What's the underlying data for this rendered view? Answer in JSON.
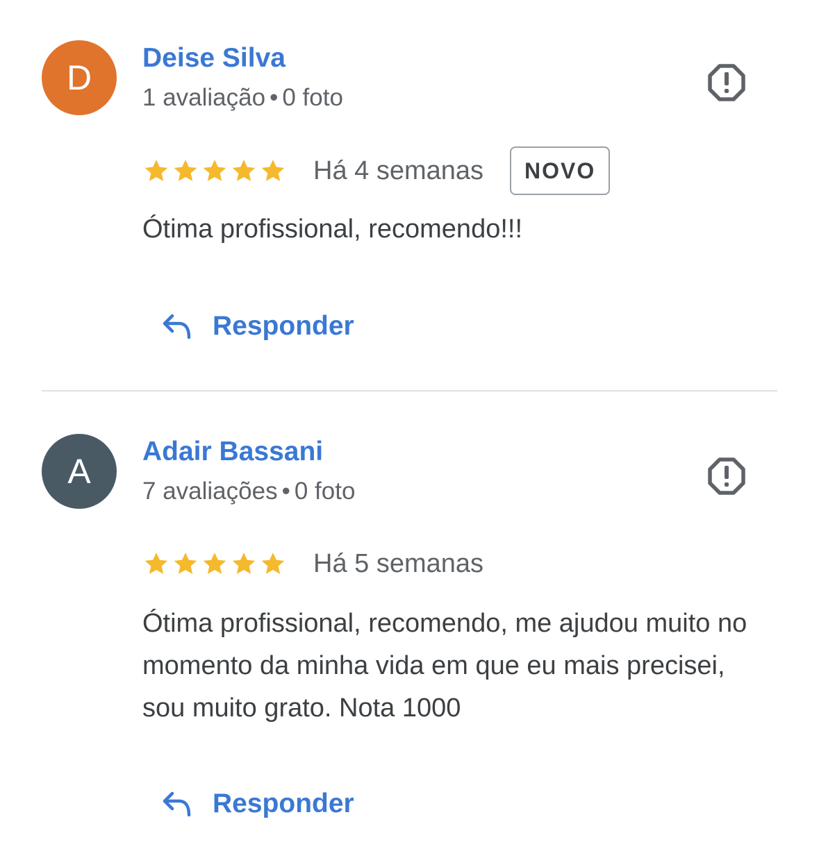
{
  "colors": {
    "accent": "#3a78d4",
    "star": "#f4b92c",
    "text": "#3c4043",
    "secondary_text": "#5f6368"
  },
  "reviews": [
    {
      "avatar_letter": "D",
      "avatar_color": "#e0742d",
      "name": "Deise Silva",
      "reviews_count": "1 avaliação",
      "separator": "•",
      "photos_count": "0 foto",
      "rating": 5,
      "date": "Há 4 semanas",
      "badge": "NOVO",
      "text": "Ótima profissional, recomendo!!!",
      "reply_label": "Responder",
      "report_icon": "report-flag-icon",
      "reply_icon": "reply-arrow-icon"
    },
    {
      "avatar_letter": "A",
      "avatar_color": "#4a5a64",
      "name": "Adair Bassani",
      "reviews_count": "7 avaliações",
      "separator": "•",
      "photos_count": "0 foto",
      "rating": 5,
      "date": "Há 5 semanas",
      "text": "Ótima profissional, recomendo, me ajudou muito no momento da minha vida em que eu mais precisei, sou muito grato. Nota 1000",
      "reply_label": "Responder",
      "report_icon": "report-flag-icon",
      "reply_icon": "reply-arrow-icon"
    }
  ]
}
